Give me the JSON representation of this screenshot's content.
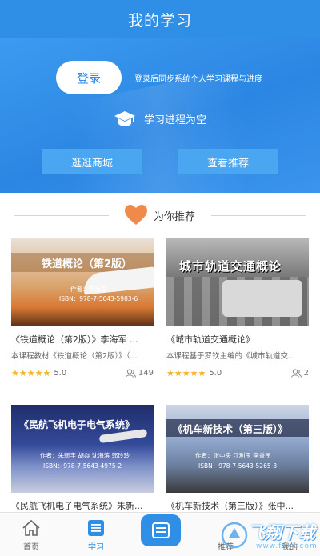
{
  "header": {
    "title": "我的学习"
  },
  "hero": {
    "login_label": "登录",
    "login_tip": "登录后同步系统个人学习课程与进度",
    "progress_text": "学习进程为空",
    "mall_label": "逛逛商城",
    "recommend_label": "查看推荐"
  },
  "recommend": {
    "title": "为你推荐",
    "books": [
      {
        "cover_title": "铁道概论（第2版）",
        "cover_author": "作者：李海军",
        "cover_isbn": "ISBN：978-7-5643-5983-6",
        "title": "《铁道概论（第2版）》李海军 ...",
        "desc": "本课程教材《铁道概论（第2版）》（...",
        "stars": "★★★★★",
        "score": "5.0",
        "count": "149"
      },
      {
        "cover_title": "城市轨道交通概论",
        "title": "《城市轨道交通概论》",
        "desc": "本课程基于罗钦主编的《城市轨道交...",
        "stars": "★★★★★",
        "score": "5.0",
        "count": "2"
      },
      {
        "cover_title": "《民航飞机电子电气系统》",
        "cover_author": "作者：朱新宇 胡焱 沈海滨 郭玲玲",
        "cover_isbn": "ISBN：978-7-5643-4975-2",
        "title": "《民航飞机电子电气系统》朱新..."
      },
      {
        "cover_title": "《机车新技术（第三版）》",
        "cover_author": "作者：张中央 江利玉 李益民",
        "cover_isbn": "ISBN：978-7-5643-5265-3",
        "title": "《机车新技术（第三版）》张中..."
      }
    ]
  },
  "tabbar": {
    "home": "首页",
    "study": "学习",
    "tab4": "推荐",
    "tab5": "我的"
  },
  "watermark": {
    "big": "飞翔下载",
    "small": "www.fxxz.com"
  },
  "colors": {
    "primary": "#2f8fe6",
    "star": "#f6b322",
    "heart": "#f08a4b"
  },
  "icons": [
    "graduation-cap-icon",
    "heart-icon",
    "star-icon",
    "user-icon",
    "home-icon",
    "book-icon",
    "menu-icon"
  ]
}
